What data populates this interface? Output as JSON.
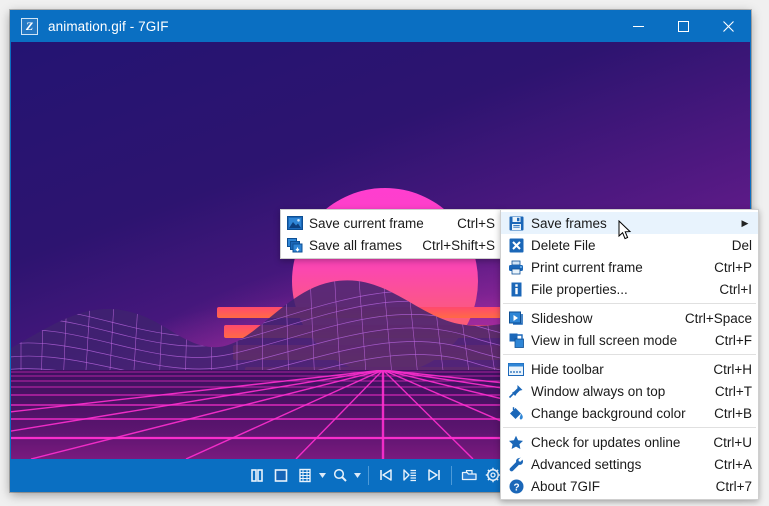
{
  "window": {
    "title": "animation.gif - 7GIF",
    "app_icon": "app-logo-icon",
    "controls": {
      "minimize": "minimize-icon",
      "maximize": "maximize-icon",
      "close": "close-icon"
    }
  },
  "image": {
    "description": "Retrowave synthwave animation frame: magenta sun, wireframe mountains, neon perspective grid",
    "colors": {
      "sky_top": "#241472",
      "sky_bottom": "#b32a9e",
      "sun_top": "#ff3ed0",
      "sun_bottom": "#ff6a4f",
      "grid_line": "#ff2fd0",
      "stripe": "#ff5a55"
    }
  },
  "toolbar": {
    "buttons": [
      {
        "name": "pause-button",
        "icon": "pause-icon"
      },
      {
        "name": "stop-button",
        "icon": "stop-icon"
      },
      {
        "name": "frames-button",
        "icon": "film-strip-icon",
        "has_caret": true
      },
      {
        "name": "zoom-button",
        "icon": "magnifier-icon",
        "has_caret": true
      },
      {
        "name": "first-frame-button",
        "icon": "skip-start-icon"
      },
      {
        "name": "frame-list-button",
        "icon": "frame-list-icon"
      },
      {
        "name": "last-frame-button",
        "icon": "skip-end-icon"
      },
      {
        "name": "open-file-button",
        "icon": "open-folder-icon"
      },
      {
        "name": "settings-button",
        "icon": "gear-icon",
        "has_caret": true
      }
    ]
  },
  "context_menu": {
    "items": [
      {
        "icon": "save-floppy-icon",
        "label": "Save frames",
        "accel": "",
        "submenu": true,
        "highlighted": true
      },
      {
        "icon": "delete-x-icon",
        "label": "Delete File",
        "accel": "Del",
        "submenu": false,
        "highlighted": false
      },
      {
        "icon": "printer-icon",
        "label": "Print current frame",
        "accel": "Ctrl+P",
        "submenu": false,
        "highlighted": false
      },
      {
        "icon": "info-icon",
        "label": "File properties...",
        "accel": "Ctrl+I",
        "submenu": false,
        "highlighted": false
      },
      {
        "separator": true
      },
      {
        "icon": "slideshow-icon",
        "label": "Slideshow",
        "accel": "Ctrl+Space",
        "submenu": false,
        "highlighted": false
      },
      {
        "icon": "fullscreen-icon",
        "label": "View in full screen mode",
        "accel": "Ctrl+F",
        "submenu": false,
        "highlighted": false
      },
      {
        "separator": true
      },
      {
        "icon": "hide-toolbar-icon",
        "label": "Hide toolbar",
        "accel": "Ctrl+H",
        "submenu": false,
        "highlighted": false
      },
      {
        "icon": "pin-icon",
        "label": "Window always on top",
        "accel": "Ctrl+T",
        "submenu": false,
        "highlighted": false
      },
      {
        "icon": "paint-bucket-icon",
        "label": "Change background color",
        "accel": "Ctrl+B",
        "submenu": false,
        "highlighted": false
      },
      {
        "separator": true
      },
      {
        "icon": "star-icon",
        "label": "Check for updates online",
        "accel": "Ctrl+U",
        "submenu": false,
        "highlighted": false
      },
      {
        "icon": "wrench-icon",
        "label": "Advanced settings",
        "accel": "Ctrl+A",
        "submenu": false,
        "highlighted": false
      },
      {
        "icon": "help-icon",
        "label": "About 7GIF",
        "accel": "Ctrl+7",
        "submenu": false,
        "highlighted": false
      }
    ]
  },
  "submenu": {
    "items": [
      {
        "icon": "picture-icon",
        "label": "Save current frame",
        "accel": "Ctrl+S"
      },
      {
        "icon": "multi-frames-icon",
        "label": "Save all frames",
        "accel": "Ctrl+Shift+S"
      }
    ]
  }
}
